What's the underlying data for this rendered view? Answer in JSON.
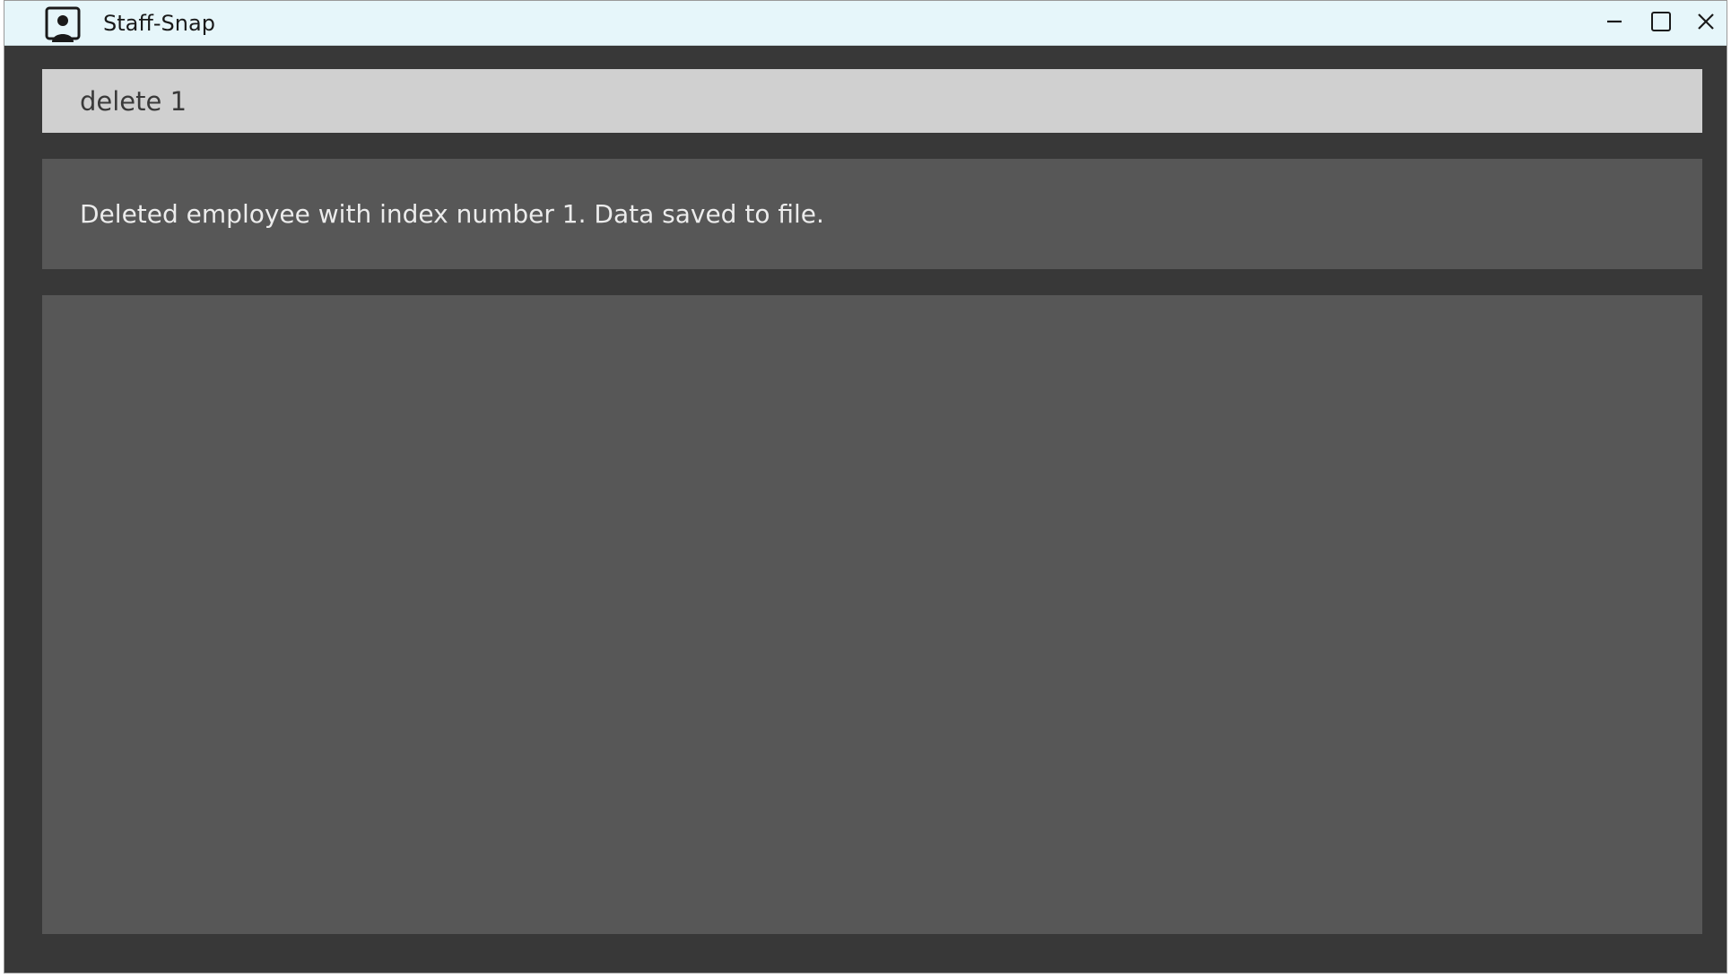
{
  "window": {
    "title": "Staff-Snap",
    "app_icon": "person-badge-icon",
    "controls": {
      "minimize_icon": "minimize-icon",
      "maximize_icon": "maximize-icon",
      "close_icon": "close-icon"
    }
  },
  "command": {
    "value": "delete 1"
  },
  "result": {
    "message": "Deleted employee with index number 1. Data saved to file."
  },
  "employee_list": {
    "items": []
  },
  "colors": {
    "titlebar_bg": "#e6f6fa",
    "window_bg": "#383838",
    "command_bg": "#d0d0d0",
    "panel_bg": "#575757",
    "result_text": "#ececec"
  }
}
